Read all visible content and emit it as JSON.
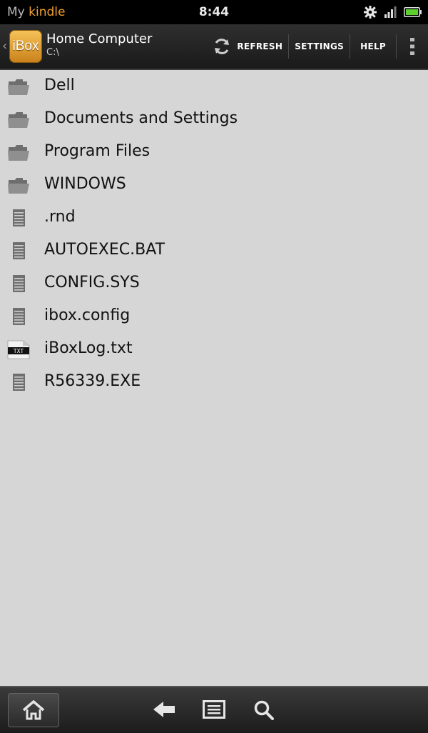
{
  "status_bar": {
    "brand_my": "My",
    "brand_kindle": "kindle",
    "time": "8:44",
    "icons": [
      "gear-icon",
      "signal-icon",
      "battery-icon"
    ]
  },
  "action_bar": {
    "app_logo_text": "iBox",
    "title": "Home Computer",
    "subtitle": "C:\\",
    "refresh_label": "REFRESH",
    "settings_label": "SETTINGS",
    "help_label": "HELP",
    "icons": [
      "back-chevron-icon",
      "refresh-icon",
      "overflow-menu-icon"
    ]
  },
  "files": [
    {
      "name": "Dell",
      "type": "folder"
    },
    {
      "name": "Documents and Settings",
      "type": "folder"
    },
    {
      "name": "Program Files",
      "type": "folder"
    },
    {
      "name": "WINDOWS",
      "type": "folder"
    },
    {
      "name": ".rnd",
      "type": "file"
    },
    {
      "name": "AUTOEXEC.BAT",
      "type": "file"
    },
    {
      "name": "CONFIG.SYS",
      "type": "file"
    },
    {
      "name": "ibox.config",
      "type": "file"
    },
    {
      "name": "iBoxLog.txt",
      "type": "txt",
      "badge": "TXT"
    },
    {
      "name": "R56339.EXE",
      "type": "file"
    }
  ],
  "nav_bar": {
    "icons": [
      "home-icon",
      "back-arrow-icon",
      "menu-icon",
      "search-icon"
    ]
  },
  "colors": {
    "accent": "#f0a030",
    "background": "#d6d6d6",
    "bar": "#1a1a1a"
  }
}
